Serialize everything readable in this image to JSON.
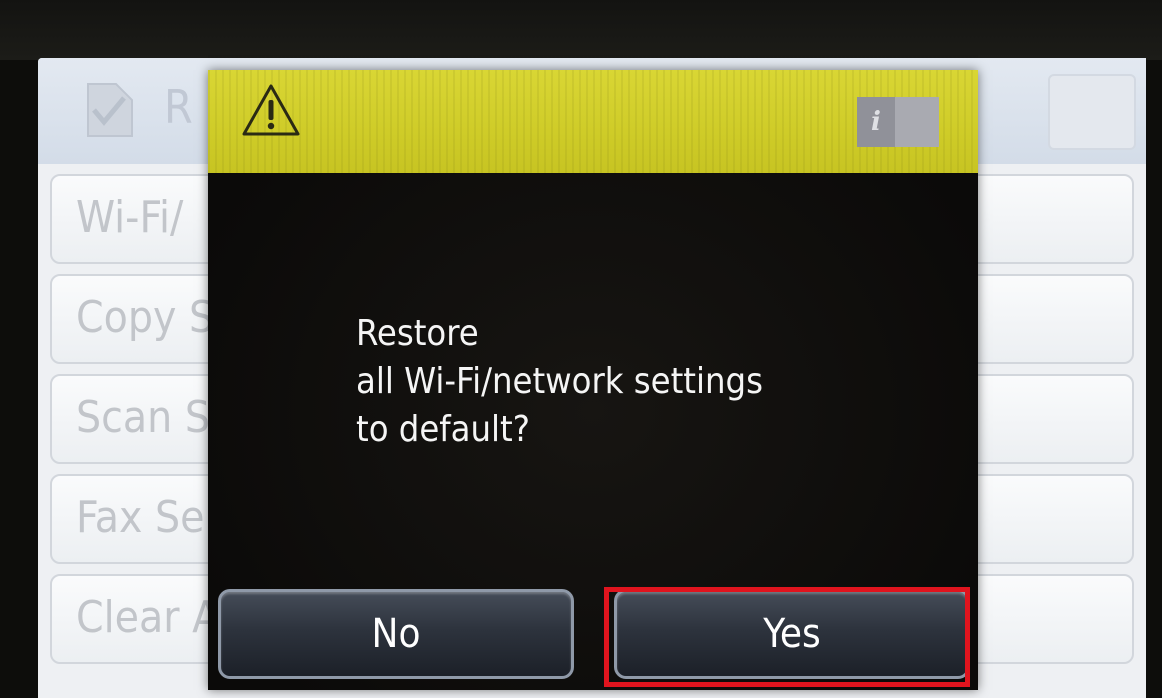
{
  "background_menu": {
    "title": "R",
    "items": [
      "Wi-Fi/",
      "Copy S",
      "Scan S",
      "Fax Se",
      "Clear A"
    ]
  },
  "dialog": {
    "warning_icon": "warning-triangle-icon",
    "info_icon": "info-icon",
    "message_lines": [
      "Restore",
      "all Wi-Fi/network settings",
      "to default?"
    ],
    "buttons": {
      "no": "No",
      "yes": "Yes"
    }
  },
  "colors": {
    "dialog_header": "#d6d330",
    "highlight": "#e0141e",
    "dialog_body": "#0b0a09"
  }
}
